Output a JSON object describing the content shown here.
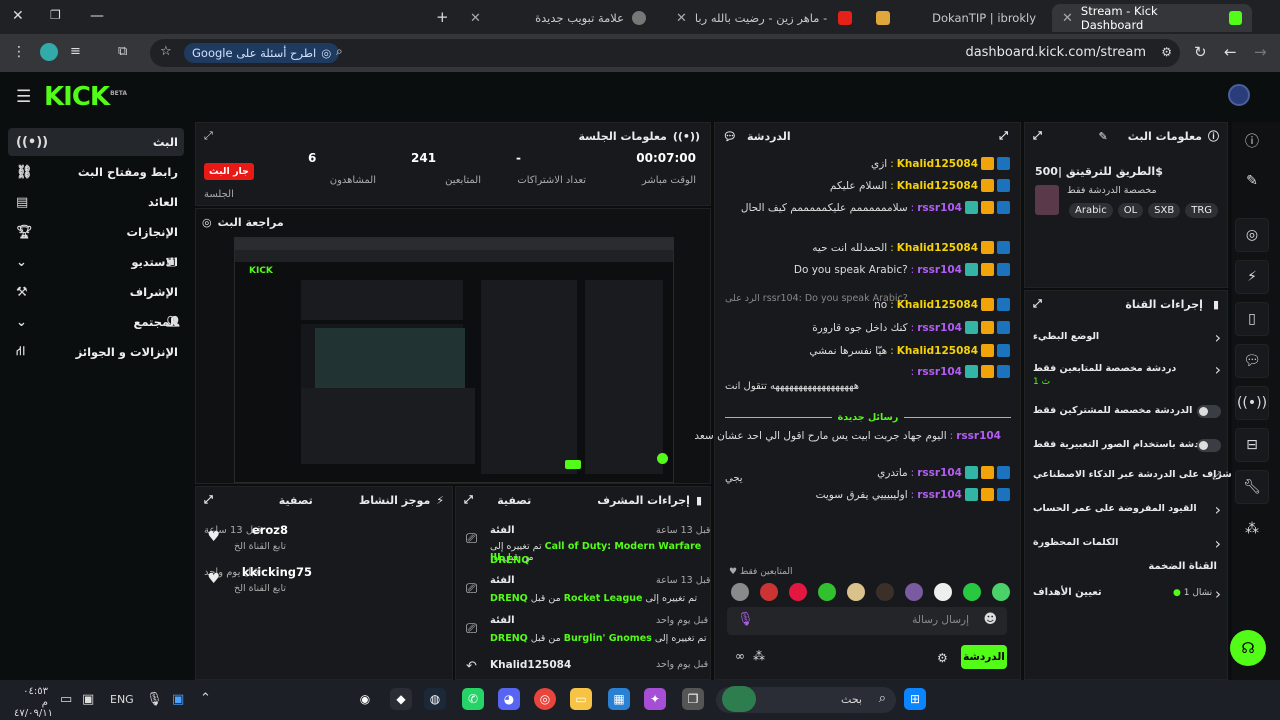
{
  "browser": {
    "tabs": [
      {
        "title": "Stream - Kick Dashboard",
        "active": true
      },
      {
        "title": "DokanTIP | ibrokly",
        "active": false
      },
      {
        "title": "ماهر زين - رضيت بالله ربا - YouTube",
        "active": false
      },
      {
        "title": "علامة تبويب جديدة",
        "active": false
      }
    ],
    "url": "dashboard.kick.com/stream",
    "google_pill": "Google اطرح أسئلة على"
  },
  "brand": {
    "logo": "KICK",
    "tag": "BETA"
  },
  "sidebar": {
    "items": [
      {
        "label": "البث",
        "active": true
      },
      {
        "label": "رابط ومفتاح البث"
      },
      {
        "label": "العائد"
      },
      {
        "label": "الإنجازات"
      },
      {
        "label": "الاستديو"
      },
      {
        "label": "الإشراف"
      },
      {
        "label": "المجتمع"
      },
      {
        "label": "الإنزالات و الجوائز"
      }
    ]
  },
  "session": {
    "title": "معلومات الجلسة",
    "stats": [
      {
        "value": "00:07:00",
        "label": "الوقت مباشر"
      },
      {
        "value": "-",
        "label": "تعداد الاشتراكات"
      },
      {
        "value": "241",
        "label": "المتابعين"
      },
      {
        "value": "6",
        "label": "المشاهدون"
      }
    ],
    "live_badge": "جار البث",
    "session_label": "الجلسة"
  },
  "preview": {
    "title": "مراجعة البث"
  },
  "activity": {
    "title": "موجز النشاط",
    "filter": "تصفية",
    "items": [
      {
        "user": "eroz8",
        "time": "قبل 13 ساعة",
        "text": "تابع القناة الخ"
      },
      {
        "user": "kkicking75",
        "time": "قبل يوم واحد",
        "text": "تابع القناة الخ"
      }
    ]
  },
  "modactions": {
    "title": "إجراءات المشرف",
    "filter": "تصفية",
    "items": [
      {
        "head": "الفئة",
        "time": "قبل 13 ساعة",
        "pre": "تم تغييره إلى",
        "value": "Call of Duty: Modern Warfare III",
        "mid": "من قبل",
        "by": "DRENQ"
      },
      {
        "head": "الفئة",
        "time": "قبل 13 ساعة",
        "pre": "تم تغييره إلى",
        "value": "Rocket League",
        "mid": "من قبل",
        "by": "DRENQ"
      },
      {
        "head": "الفئة",
        "time": "قبل يوم واحد",
        "pre": "تم تغييره إلى",
        "value": "Burglin' Gnomes",
        "mid": "من قبل",
        "by": "DRENQ"
      },
      {
        "head": "Khalid125084",
        "time": "قبل يوم واحد"
      }
    ]
  },
  "chat": {
    "title": "الدردشة",
    "lines": [
      {
        "user": "Khalid125084",
        "color": "#f5d20a",
        "text": "ازي"
      },
      {
        "user": "Khalid125084",
        "color": "#f5d20a",
        "text": "السلام عليكم"
      },
      {
        "user": "rssr104",
        "color": "#b35df5",
        "text": "سلاممممممم عليكمممممم كيف الحال"
      },
      {
        "user": "Khalid125084",
        "color": "#f5d20a",
        "text": "الحمدلله انت حيه"
      },
      {
        "user": "rssr104",
        "color": "#b35df5",
        "text": "Do you speak Arabic?"
      },
      {
        "user": "Khalid125084",
        "color": "#f5d20a",
        "text": "no"
      },
      {
        "user": "rssr104",
        "color": "#b35df5",
        "text": "كنك داخل جوه قارورة"
      },
      {
        "user": "Khalid125084",
        "color": "#f5d20a",
        "text": "هيّا نفسرها نمشي"
      },
      {
        "user": "rssr104",
        "color": "#b35df5",
        "text": ""
      },
      {
        "user": "rssr104",
        "color": "#b35df5",
        "text": "اليوم جهاد جربت ابيت يس مارح اقول الي احد عشان سعد"
      },
      {
        "user": "rssr104",
        "color": "#b35df5",
        "text": "ماتدري"
      },
      {
        "user": "rssr104",
        "color": "#b35df5",
        "text": "اوليبيييي يفرق سويت"
      }
    ],
    "reply_hint": "الرد على rssr104: Do you speak Arabic?",
    "long_text": "ههههههههههههههههههه تتقول انت",
    "extra": "يجي",
    "new_messages": "رسائل جديدة",
    "followers_only": "المتابعين فقط",
    "input_placeholder": "إرسال رسالة",
    "send_button": "الدردشة"
  },
  "streaminfo": {
    "title": "معلومات البث",
    "stream_title": "الطريق للترقيتق |500$",
    "subtitle": "مخصصة الدردشة فقط",
    "tags": [
      "TRG",
      "SXB",
      "OL",
      "Arabic"
    ]
  },
  "channel_actions": {
    "title": "إجراءات القناة",
    "items": [
      {
        "label": "الوضع البطيء",
        "control": "chevron"
      },
      {
        "label": "دردشة مخصصة للمتابعين فقط",
        "sub": "1 ث",
        "control": "chevron"
      },
      {
        "label": "الدردشة مخصصة للمشتركين فقط",
        "control": "toggle"
      },
      {
        "label": "الدردشة باستخدام الصور التعبيرية فقط",
        "control": "toggle"
      },
      {
        "label": "الإشراف على الدردشة عبر الذكاء الاصطناعي",
        "control": "external"
      },
      {
        "label": "القيود المفروضة على عمر الحساب",
        "control": "chevron"
      },
      {
        "label": "الكلمات المحظورة",
        "control": "chevron"
      }
    ],
    "section": "القناة الضخمة",
    "goals": "تعيين الأهداف",
    "goals_status": "نشال 1"
  },
  "taskbar": {
    "search": "بحث",
    "lang": "ENG",
    "time": "٠٤:٥٣ م",
    "date": "٤٧/٠٩/١١"
  }
}
